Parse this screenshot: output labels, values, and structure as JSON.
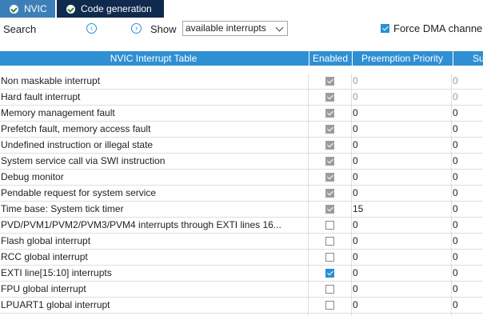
{
  "tabs": [
    {
      "label": "NVIC",
      "active": false
    },
    {
      "label": "Code generation",
      "active": true
    }
  ],
  "toolbar": {
    "search_label": "Search",
    "show_label": "Show",
    "show_value": "available interrupts",
    "force_dma_label": "Force DMA channe",
    "force_dma_checked": true
  },
  "table": {
    "headers": {
      "name": "NVIC Interrupt Table",
      "enabled": "Enabled",
      "preemption": "Preemption Priority",
      "sub": "Su"
    },
    "rows": [
      {
        "name": "Non maskable interrupt",
        "enabled": "disabled-checked",
        "preemption": "0",
        "sub": "0",
        "muted": true
      },
      {
        "name": "Hard fault interrupt",
        "enabled": "disabled-checked",
        "preemption": "0",
        "sub": "0",
        "muted": true
      },
      {
        "name": "Memory management fault",
        "enabled": "disabled-checked",
        "preemption": "0",
        "sub": "0",
        "muted": false
      },
      {
        "name": "Prefetch fault, memory access fault",
        "enabled": "disabled-checked",
        "preemption": "0",
        "sub": "0",
        "muted": false
      },
      {
        "name": "Undefined instruction or illegal state",
        "enabled": "disabled-checked",
        "preemption": "0",
        "sub": "0",
        "muted": false
      },
      {
        "name": "System service call via SWI instruction",
        "enabled": "disabled-checked",
        "preemption": "0",
        "sub": "0",
        "muted": false
      },
      {
        "name": "Debug monitor",
        "enabled": "disabled-checked",
        "preemption": "0",
        "sub": "0",
        "muted": false
      },
      {
        "name": "Pendable request for system service",
        "enabled": "disabled-checked",
        "preemption": "0",
        "sub": "0",
        "muted": false
      },
      {
        "name": "Time base: System tick timer",
        "enabled": "disabled-checked",
        "preemption": "15",
        "sub": "0",
        "muted": false
      },
      {
        "name": "PVD/PVM1/PVM2/PVM3/PVM4 interrupts through EXTI lines 16...",
        "enabled": "unchecked",
        "preemption": "0",
        "sub": "0",
        "muted": false
      },
      {
        "name": "Flash global interrupt",
        "enabled": "unchecked",
        "preemption": "0",
        "sub": "0",
        "muted": false
      },
      {
        "name": "RCC global interrupt",
        "enabled": "unchecked",
        "preemption": "0",
        "sub": "0",
        "muted": false
      },
      {
        "name": "EXTI line[15:10] interrupts",
        "enabled": "checked",
        "preemption": "0",
        "sub": "0",
        "muted": false
      },
      {
        "name": "FPU global interrupt",
        "enabled": "unchecked",
        "preemption": "0",
        "sub": "0",
        "muted": false
      },
      {
        "name": "LPUART1 global interrupt",
        "enabled": "unchecked",
        "preemption": "0",
        "sub": "0",
        "muted": false
      }
    ]
  },
  "colors": {
    "header_blue": "#2f8fd3",
    "active_tab": "#0f2a4c",
    "inactive_tab": "#3c7fb8",
    "checkbox_blue": "#2a8ed8"
  }
}
